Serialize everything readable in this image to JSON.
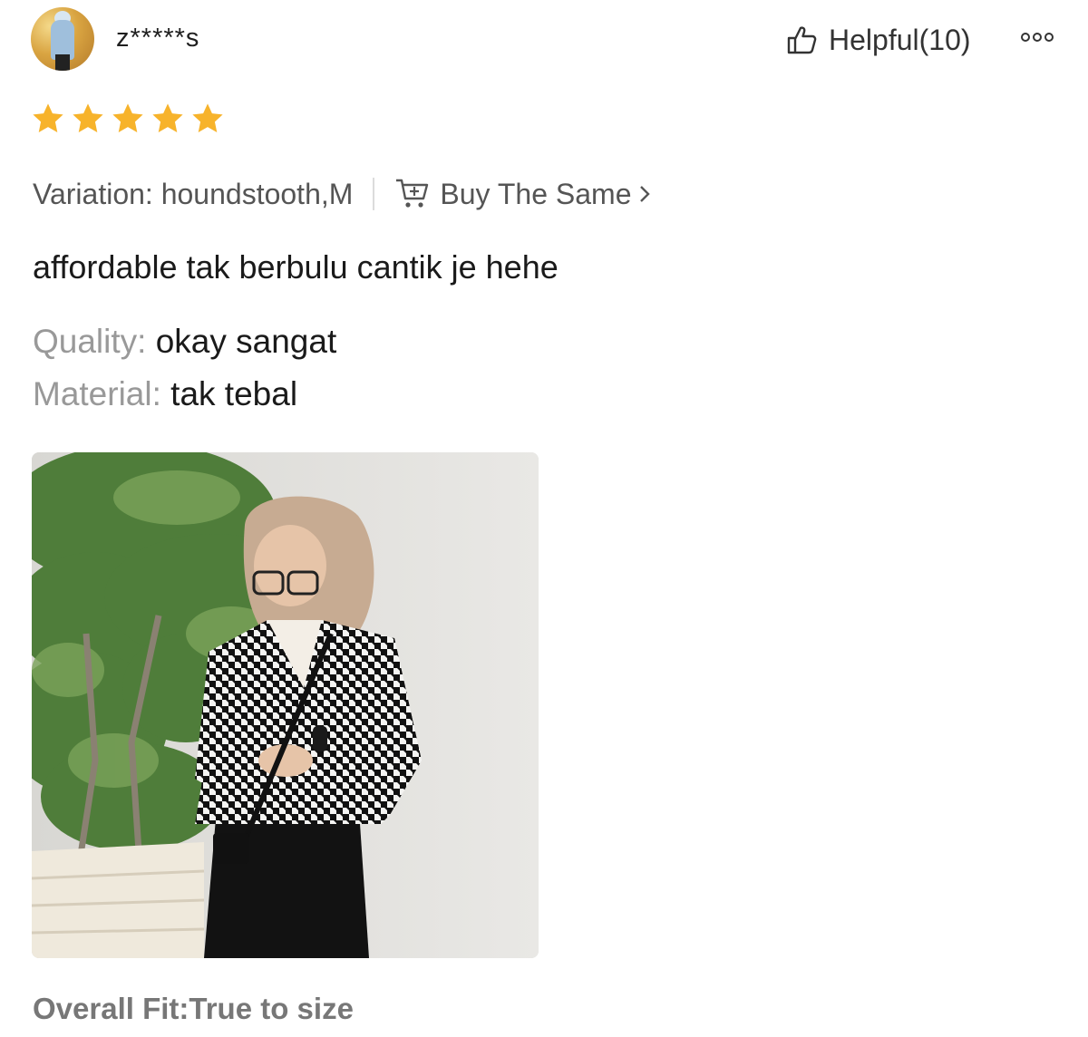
{
  "review": {
    "username": "z*****s",
    "helpful_label": "Helpful(10)",
    "rating": 5,
    "variation_text": "Variation: houndstooth,M",
    "buy_same_label": "Buy The Same",
    "comment": "affordable tak berbulu cantik je hehe",
    "attributes": [
      {
        "key": "Quality:",
        "value": "okay sangat"
      },
      {
        "key": "Material:",
        "value": "tak tebal"
      }
    ],
    "overall_fit": "Overall Fit:True to size"
  },
  "icons": {
    "helpful": "thumbs-up-icon",
    "more": "more-options-icon",
    "star": "star-icon",
    "cart": "cart-icon",
    "chevron": "chevron-right-icon"
  },
  "colors": {
    "star": "#F7B32B",
    "label_gray": "#999999",
    "text_dark": "#1A1A1A"
  }
}
